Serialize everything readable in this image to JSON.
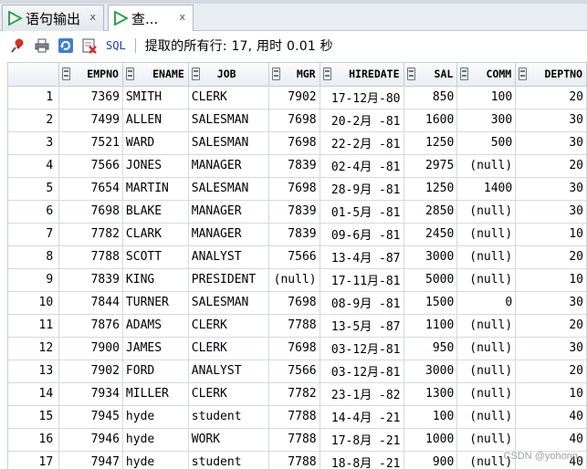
{
  "tabs": [
    {
      "label": "语句输出",
      "close": "x"
    },
    {
      "label": "查...",
      "close": "x"
    }
  ],
  "toolbar": {
    "sql_label": "SQL",
    "status": "提取的所有行: 17, 用时 0.01 秒"
  },
  "icons": [
    "pin-icon",
    "print-icon",
    "refresh-icon",
    "export-icon"
  ],
  "colors": {
    "accent": "#1a3fb8",
    "run_green": "#2ea44f"
  },
  "table": {
    "columns": [
      "EMPNO",
      "ENAME",
      "JOB",
      "MGR",
      "HIREDATE",
      "SAL",
      "COMM",
      "DEPTNO"
    ],
    "rows": [
      [
        "1",
        "7369",
        "SMITH",
        "CLERK",
        "7902",
        "17-12月-80",
        "850",
        "100",
        "20"
      ],
      [
        "2",
        "7499",
        "ALLEN",
        "SALESMAN",
        "7698",
        "20-2月 -81",
        "1600",
        "300",
        "30"
      ],
      [
        "3",
        "7521",
        "WARD",
        "SALESMAN",
        "7698",
        "22-2月 -81",
        "1250",
        "500",
        "30"
      ],
      [
        "4",
        "7566",
        "JONES",
        "MANAGER",
        "7839",
        "02-4月 -81",
        "2975",
        "(null)",
        "20"
      ],
      [
        "5",
        "7654",
        "MARTIN",
        "SALESMAN",
        "7698",
        "28-9月 -81",
        "1250",
        "1400",
        "30"
      ],
      [
        "6",
        "7698",
        "BLAKE",
        "MANAGER",
        "7839",
        "01-5月 -81",
        "2850",
        "(null)",
        "30"
      ],
      [
        "7",
        "7782",
        "CLARK",
        "MANAGER",
        "7839",
        "09-6月 -81",
        "2450",
        "(null)",
        "10"
      ],
      [
        "8",
        "7788",
        "SCOTT",
        "ANALYST",
        "7566",
        "13-4月 -87",
        "3000",
        "(null)",
        "20"
      ],
      [
        "9",
        "7839",
        "KING",
        "PRESIDENT",
        "(null)",
        "17-11月-81",
        "5000",
        "(null)",
        "10"
      ],
      [
        "10",
        "7844",
        "TURNER",
        "SALESMAN",
        "7698",
        "08-9月 -81",
        "1500",
        "0",
        "30"
      ],
      [
        "11",
        "7876",
        "ADAMS",
        "CLERK",
        "7788",
        "13-5月 -87",
        "1100",
        "(null)",
        "20"
      ],
      [
        "12",
        "7900",
        "JAMES",
        "CLERK",
        "7698",
        "03-12月-81",
        "950",
        "(null)",
        "30"
      ],
      [
        "13",
        "7902",
        "FORD",
        "ANALYST",
        "7566",
        "03-12月-81",
        "3000",
        "(null)",
        "20"
      ],
      [
        "14",
        "7934",
        "MILLER",
        "CLERK",
        "7782",
        "23-1月 -82",
        "1300",
        "(null)",
        "10"
      ],
      [
        "15",
        "7945",
        "hyde",
        "student",
        "7788",
        "14-4月 -21",
        "100",
        "(null)",
        "40"
      ],
      [
        "16",
        "7946",
        "hyde",
        "WORK",
        "7788",
        "17-8月 -21",
        "1000",
        "(null)",
        "40"
      ],
      [
        "17",
        "7947",
        "hyde",
        "student",
        "7788",
        "18-8月 -21",
        "900",
        "(null)",
        "40"
      ]
    ]
  },
  "watermark": "CSDN @yohonn"
}
